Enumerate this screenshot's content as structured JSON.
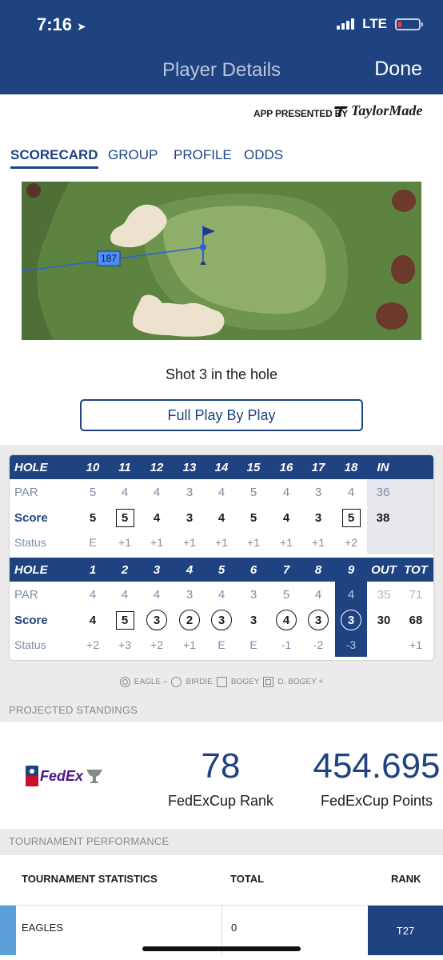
{
  "status_bar": {
    "time": "7:16",
    "network": "LTE"
  },
  "nav": {
    "title": "Player Details",
    "done_label": "Done"
  },
  "sponsor": {
    "label": "APP PRESENTED BY",
    "brand": "TaylorMade"
  },
  "tabs": [
    "SCORECARD",
    "GROUP",
    "PROFILE",
    "ODDS"
  ],
  "active_tab": "SCORECARD",
  "hole_view": {
    "distance_label": "187"
  },
  "shot_text": "Shot 3 in the hole",
  "play_by_play_label": "Full Play By Play",
  "scorecard": {
    "back_nine": {
      "header": [
        "HOLE",
        "10",
        "11",
        "12",
        "13",
        "14",
        "15",
        "16",
        "17",
        "18",
        "IN"
      ],
      "par": [
        "PAR",
        "5",
        "4",
        "4",
        "3",
        "4",
        "5",
        "4",
        "3",
        "4",
        "36"
      ],
      "score": [
        "Score",
        "5",
        "5",
        "4",
        "3",
        "4",
        "5",
        "4",
        "3",
        "5",
        "38"
      ],
      "status": [
        "Status",
        "E",
        "+1",
        "+1",
        "+1",
        "+1",
        "+1",
        "+1",
        "+1",
        "+2",
        ""
      ]
    },
    "front_nine": {
      "header": [
        "HOLE",
        "1",
        "2",
        "3",
        "4",
        "5",
        "6",
        "7",
        "8",
        "9",
        "OUT",
        "TOT"
      ],
      "par": [
        "PAR",
        "4",
        "4",
        "4",
        "3",
        "4",
        "3",
        "5",
        "4",
        "4",
        "35",
        "71"
      ],
      "score": [
        "Score",
        "4",
        "5",
        "3",
        "2",
        "3",
        "3",
        "4",
        "3",
        "3",
        "30",
        "68"
      ],
      "status": [
        "Status",
        "+2",
        "+3",
        "+2",
        "+1",
        "E",
        "E",
        "-1",
        "-2",
        "-3",
        "",
        "+1"
      ]
    },
    "legend": [
      "EAGLE –",
      "BIRDIE",
      "BOGEY",
      "D. BOGEY +"
    ]
  },
  "projected_standings": {
    "title": "PROJECTED STANDINGS",
    "logo_text": "FedEx",
    "rank_value": "78",
    "rank_label": "FedExCup Rank",
    "points_value": "454.695",
    "points_label": "FedExCup Points"
  },
  "tournament_performance": {
    "title": "TOURNAMENT PERFORMANCE",
    "columns": [
      "TOURNAMENT STATISTICS",
      "TOTAL",
      "RANK"
    ],
    "rows": [
      {
        "stat": "EAGLES",
        "total": "0",
        "rank": "T27"
      }
    ]
  },
  "colors": {
    "brand_navy": "#1e4380",
    "accent_blue": "#5ba0d8",
    "fairway": "#557a3a",
    "green": "#8fae6a"
  }
}
